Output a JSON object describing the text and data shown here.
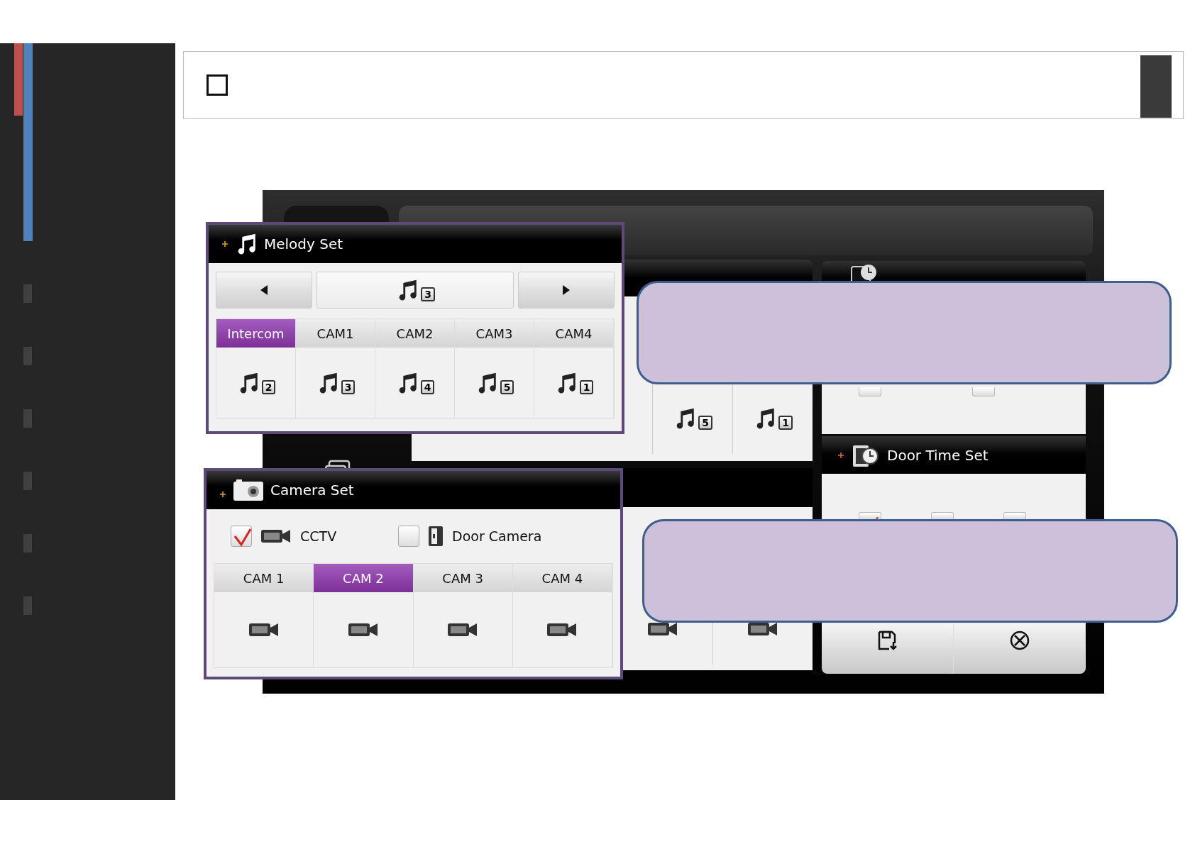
{
  "melody_set": {
    "title": "Melody Set",
    "current_melody": "3",
    "tabs": [
      {
        "label": "Intercom",
        "selected": true,
        "melody": "2"
      },
      {
        "label": "CAM1",
        "selected": false,
        "melody": "3"
      },
      {
        "label": "CAM2",
        "selected": false,
        "melody": "4"
      },
      {
        "label": "CAM3",
        "selected": false,
        "melody": "5"
      },
      {
        "label": "CAM4",
        "selected": false,
        "melody": "1"
      }
    ]
  },
  "camera_set": {
    "title": "Camera Set",
    "options": [
      {
        "kind": "cctv",
        "label": "CCTV",
        "checked": true
      },
      {
        "kind": "door",
        "label": "Door Camera",
        "checked": false
      }
    ],
    "tabs": [
      {
        "label": "CAM 1",
        "selected": false
      },
      {
        "label": "CAM 2",
        "selected": true
      },
      {
        "label": "CAM 3",
        "selected": false
      },
      {
        "label": "CAM 4",
        "selected": false
      }
    ]
  },
  "background_melody_cells": [
    {
      "melody": "5"
    },
    {
      "melody": "1"
    }
  ],
  "monitor_time_set": {
    "checkboxes": [
      {
        "checked": false
      },
      {
        "checked": false
      }
    ]
  },
  "door_time_set": {
    "title": "Door Time Set",
    "checkboxes": [
      {
        "checked": true
      },
      {
        "checked": false
      },
      {
        "checked": false
      }
    ]
  }
}
